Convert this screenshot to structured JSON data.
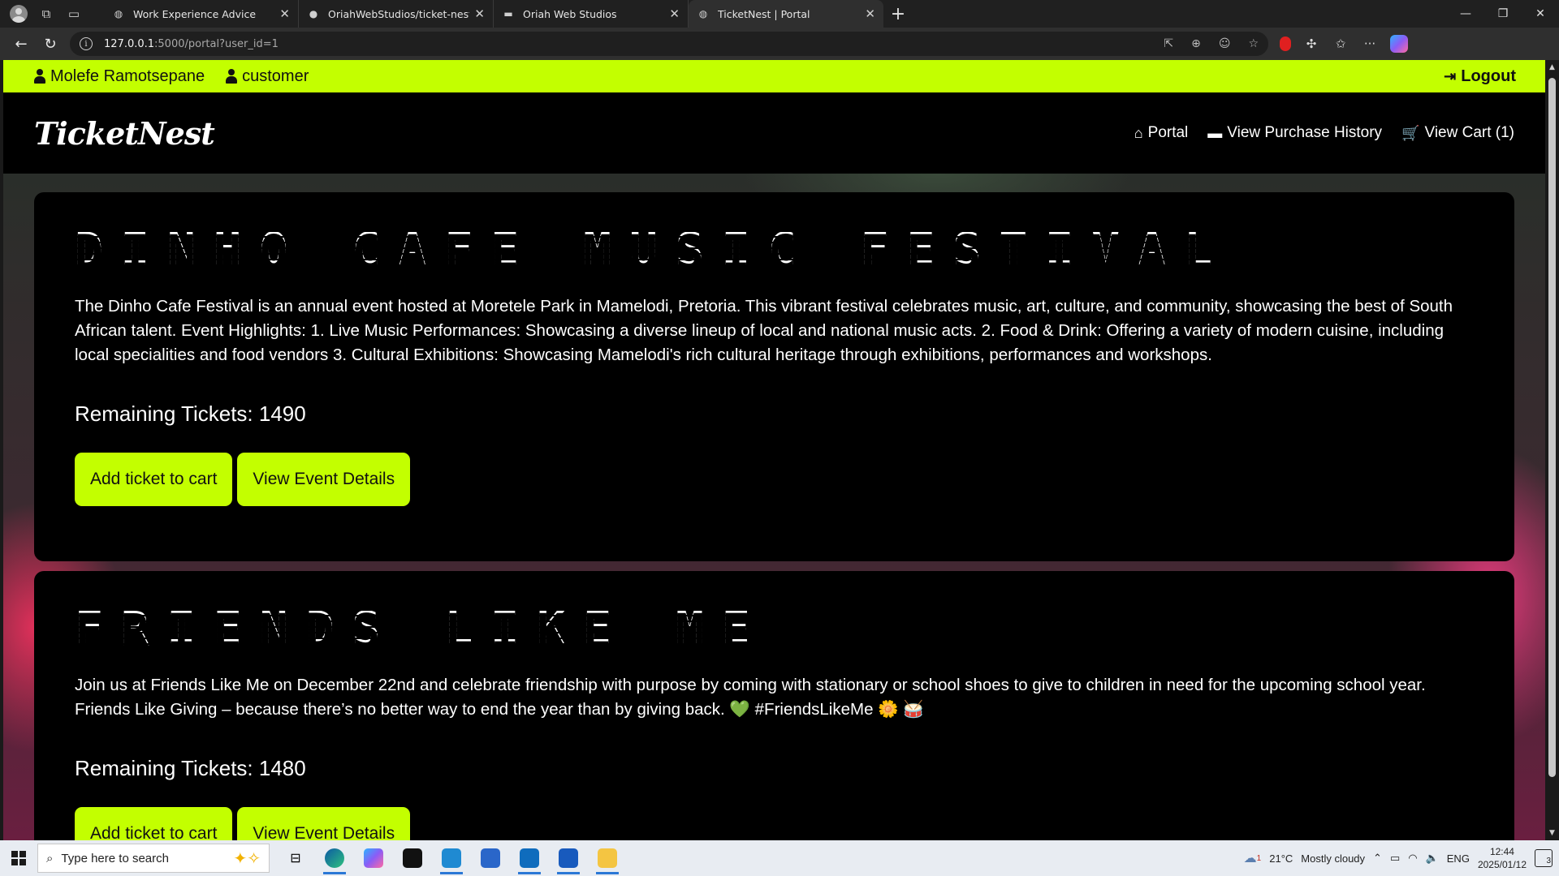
{
  "browser": {
    "tabs": [
      {
        "title": "Work Experience Advice",
        "favicon": "globe-icon"
      },
      {
        "title": "OriahWebStudios/ticket-nest",
        "favicon": "github-icon"
      },
      {
        "title": "Oriah Web Studios",
        "favicon": "oriah-icon"
      },
      {
        "title": "TicketNest | Portal",
        "favicon": "globe-icon",
        "active": true
      }
    ],
    "url_host": "127.0.0.1",
    "url_rest": ":5000/portal?user_id=1"
  },
  "userbar": {
    "name": "Molefe Ramotsepane",
    "role": "customer",
    "logout_label": "Logout"
  },
  "navbar": {
    "brand": "TicketNest",
    "portal_label": "Portal",
    "history_label": "View Purchase History",
    "cart_label": "View Cart (1)"
  },
  "events": [
    {
      "title": "DINHO CAFE MUSIC FESTIVAL",
      "description": "The Dinho Cafe Festival is an annual event hosted at Moretele Park in Mamelodi, Pretoria. This vibrant festival celebrates music, art, culture, and community, showcasing the best of South African talent. Event Highlights: 1. Live Music Performances: Showcasing a diverse lineup of local and national music acts. 2. Food & Drink: Offering a variety of modern cuisine, including local specialities and food vendors 3. Cultural Exhibitions: Showcasing Mamelodi's rich cultural heritage through exhibitions, performances and workshops.",
      "remaining": "Remaining Tickets: 1490",
      "add_label": "Add ticket to cart",
      "details_label": "View Event Details"
    },
    {
      "title": "FRIENDS LIKE ME",
      "description": "Join us at Friends Like Me on December 22nd and celebrate friendship with purpose by coming with stationary or school shoes to give to children in need for the upcoming school year. Friends Like Giving – because there’s no better way to end the year than by giving back. 💚 #FriendsLikeMe 🌼 🥁",
      "remaining": "Remaining Tickets: 1480",
      "add_label": "Add ticket to cart",
      "details_label": "View Event Details"
    }
  ],
  "taskbar": {
    "search_placeholder": "Type here to search",
    "temperature": "21°C",
    "weather": "Mostly cloudy",
    "language": "ENG",
    "time": "12:44",
    "date": "2025/01/12",
    "notification_count": "3",
    "weather_alert": "1"
  },
  "colors": {
    "accent": "#c3ff00",
    "card_bg": "#000000"
  }
}
